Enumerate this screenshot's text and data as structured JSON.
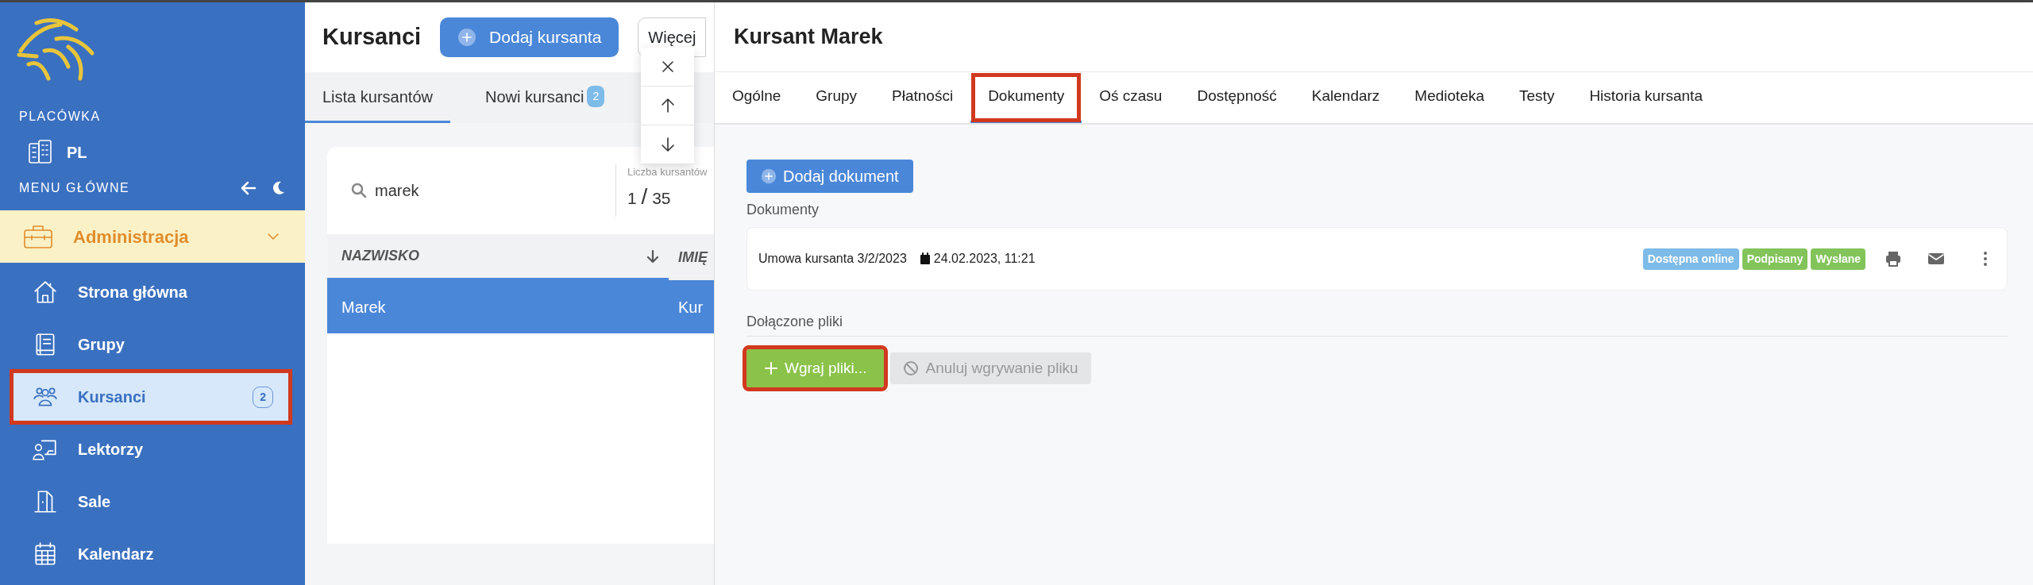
{
  "sidebar": {
    "facility_label": "PLACÓWKA",
    "facility": "PL",
    "menu_label": "MENU GŁÓWNE",
    "group": {
      "label": "Administracja",
      "expanded": true
    },
    "items": [
      {
        "label": "Strona główna",
        "selected": false,
        "highlighted": false
      },
      {
        "label": "Grupy",
        "selected": false,
        "highlighted": false
      },
      {
        "label": "Kursanci",
        "selected": true,
        "highlighted": true,
        "badge": "2"
      },
      {
        "label": "Lektorzy",
        "selected": false,
        "highlighted": false
      },
      {
        "label": "Sale",
        "selected": false,
        "highlighted": false
      },
      {
        "label": "Kalendarz",
        "selected": false,
        "highlighted": false
      }
    ]
  },
  "list_panel": {
    "title": "Kursanci",
    "add_button": "Dodaj kursanta",
    "more_button": "Więcej",
    "tabs": [
      {
        "label": "Lista kursantów",
        "selected": true
      },
      {
        "label": "Nowi kursanci",
        "badge": "2",
        "selected": false
      }
    ],
    "search": {
      "value": "marek"
    },
    "count": {
      "label": "Liczba kursantów",
      "shown": "1",
      "separator": "/",
      "total": "35"
    },
    "table": {
      "columns": [
        {
          "label": "NAZWISKO",
          "sorted": true
        },
        {
          "label": "IMIĘ",
          "sorted": false
        }
      ],
      "rows": [
        {
          "cells": [
            "Marek",
            "Kur"
          ],
          "selected": true
        }
      ]
    }
  },
  "drawer": {
    "title": "Kursant Marek",
    "tabs": [
      {
        "label": "Ogólne",
        "selected": false,
        "highlighted": false
      },
      {
        "label": "Grupy",
        "selected": false,
        "highlighted": false
      },
      {
        "label": "Płatności",
        "selected": false,
        "highlighted": false
      },
      {
        "label": "Dokumenty",
        "selected": true,
        "highlighted": true
      },
      {
        "label": "Oś czasu",
        "selected": false,
        "highlighted": false
      },
      {
        "label": "Dostępność",
        "selected": false,
        "highlighted": false
      },
      {
        "label": "Kalendarz",
        "selected": false,
        "highlighted": false
      },
      {
        "label": "Medioteka",
        "selected": false,
        "highlighted": false
      },
      {
        "label": "Testy",
        "selected": false,
        "highlighted": false
      },
      {
        "label": "Historia kursanta",
        "selected": false,
        "highlighted": false
      }
    ],
    "add_button": "Dodaj dokument",
    "documents_label": "Dokumenty",
    "documents": [
      {
        "name": "Umowa kursanta 3/2/2023",
        "date": "24.02.2023, 11:21",
        "tags": [
          {
            "label": "Dostępna online",
            "color": "#7dbbe8"
          },
          {
            "label": "Podpisany",
            "color": "#82c45a"
          },
          {
            "label": "Wysłane",
            "color": "#82c45a"
          }
        ]
      }
    ],
    "files_label": "Dołączone pliki",
    "upload_button": {
      "label": "Wgraj pliki...",
      "highlighted": true
    },
    "cancel_button": {
      "label": "Anuluj wgrywanie pliku",
      "disabled": true
    }
  }
}
